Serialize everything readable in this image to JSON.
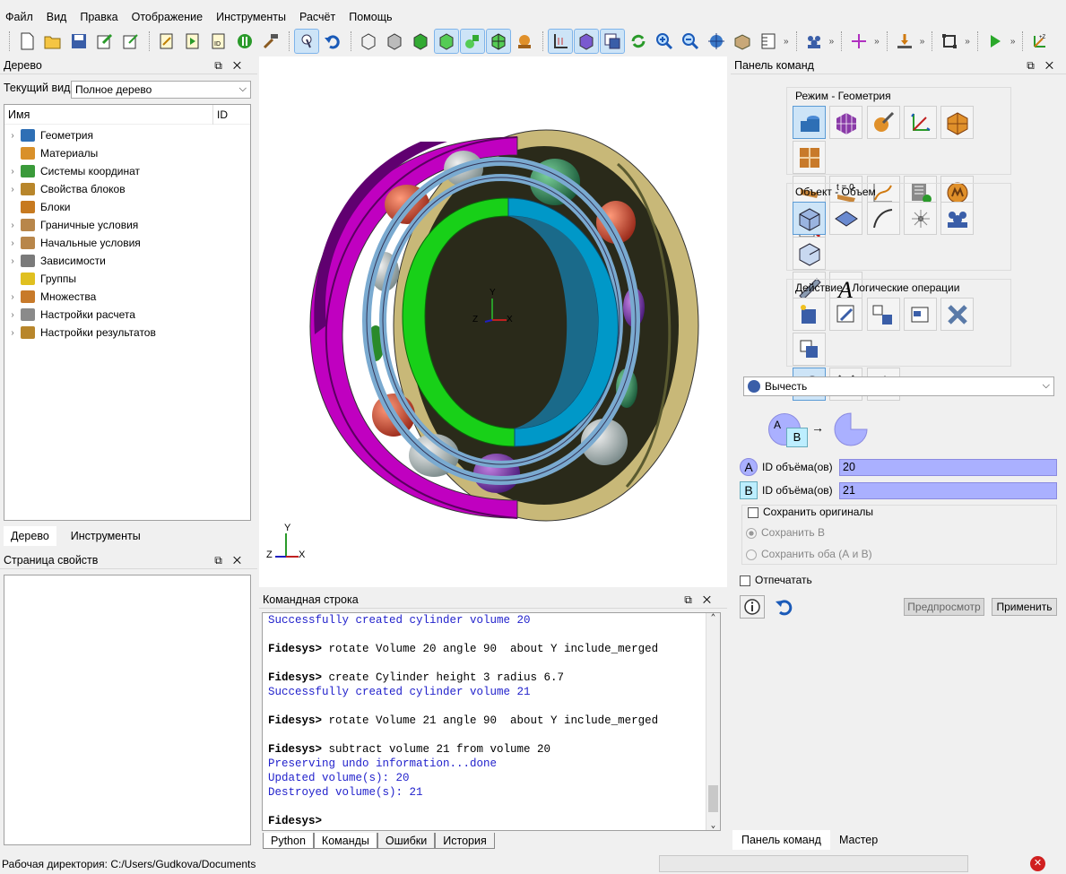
{
  "menu": [
    "Файл",
    "Вид",
    "Правка",
    "Отображение",
    "Инструменты",
    "Расчёт",
    "Помощь"
  ],
  "tree_panel": {
    "title": "Дерево",
    "current_view_label": "Текущий вид",
    "current_view_value": "Полное дерево",
    "col_name": "Имя",
    "col_id": "ID",
    "items": [
      {
        "label": "Геометрия",
        "icon": "geometry-icon",
        "expandable": true,
        "color": "#2e6fb5"
      },
      {
        "label": "Материалы",
        "icon": "materials-icon",
        "expandable": false,
        "color": "#d9902a"
      },
      {
        "label": "Системы координат",
        "icon": "coordinate-system-icon",
        "expandable": true,
        "color": "#3a9a3a"
      },
      {
        "label": "Свойства блоков",
        "icon": "block-properties-icon",
        "expandable": true,
        "color": "#b8862b"
      },
      {
        "label": "Блоки",
        "icon": "blocks-icon",
        "expandable": false,
        "color": "#c77a20"
      },
      {
        "label": "Граничные условия",
        "icon": "boundary-conditions-icon",
        "expandable": true,
        "color": "#b8864a"
      },
      {
        "label": "Начальные условия",
        "icon": "initial-conditions-icon",
        "expandable": true,
        "color": "#b8864a"
      },
      {
        "label": "Зависимости",
        "icon": "dependencies-icon",
        "expandable": true,
        "color": "#7a7a7a"
      },
      {
        "label": "Группы",
        "icon": "groups-icon",
        "expandable": false,
        "color": "#e0c020"
      },
      {
        "label": "Множества",
        "icon": "sets-icon",
        "expandable": true,
        "color": "#c87a2a"
      },
      {
        "label": "Настройки расчета",
        "icon": "calc-settings-icon",
        "expandable": true,
        "color": "#8a8a8a"
      },
      {
        "label": "Настройки результатов",
        "icon": "results-settings-icon",
        "expandable": true,
        "color": "#b8862b"
      }
    ],
    "tabs": [
      "Дерево",
      "Инструменты"
    ]
  },
  "properties_panel": {
    "title": "Страница свойств"
  },
  "command_line": {
    "title": "Командная строка",
    "lines": [
      {
        "t": "Successfully created cylinder volume 20",
        "k": "out"
      },
      {
        "t": "",
        "k": "blank"
      },
      {
        "p": "Fidesys>",
        "t": " rotate Volume 20 angle 90  about Y include_merged",
        "k": "cmd"
      },
      {
        "t": "",
        "k": "blank"
      },
      {
        "p": "Fidesys>",
        "t": " create Cylinder height 3 radius 6.7",
        "k": "cmd"
      },
      {
        "t": "Successfully created cylinder volume 21",
        "k": "out"
      },
      {
        "t": "",
        "k": "blank"
      },
      {
        "p": "Fidesys>",
        "t": " rotate Volume 21 angle 90  about Y include_merged",
        "k": "cmd"
      },
      {
        "t": "",
        "k": "blank"
      },
      {
        "p": "Fidesys>",
        "t": " subtract volume 21 from volume 20",
        "k": "cmd"
      },
      {
        "t": "Preserving undo information...done",
        "k": "out"
      },
      {
        "t": "Updated volume(s): 20",
        "k": "out"
      },
      {
        "t": "Destroyed volume(s): 21",
        "k": "out"
      },
      {
        "t": "",
        "k": "blank"
      },
      {
        "p": "Fidesys>",
        "t": "",
        "k": "cmd"
      }
    ],
    "tabs": [
      "Python",
      "Команды",
      "Ошибки",
      "История"
    ]
  },
  "command_panel": {
    "title": "Панель команд",
    "mode_group": "Режим - Геометрия",
    "object_group": "Объект - Объем",
    "action_group": "Действие - Логические операции",
    "operation": "Вычесть",
    "a_label": "A",
    "b_label": "B",
    "a_field_label": "ID объёма(ов)",
    "a_value": "20",
    "b_field_label": "ID объёма(ов)",
    "b_value": "21",
    "keep_originals": "Сохранить оригиналы",
    "keep_b": "Сохранить B",
    "keep_both": "Сохранить оба (А и В)",
    "imprint": "Отпечатать",
    "preview": "Предпросмотр",
    "apply": "Применить",
    "tabs": [
      "Панель команд",
      "Мастер"
    ]
  },
  "viewport": {
    "axis_labels": {
      "x": "X",
      "y": "Y",
      "z": "Z"
    }
  },
  "status": {
    "workdir": "Рабочая директория: C:/Users/Gudkova/Documents"
  },
  "colors": {
    "accent": "#cde4f7",
    "field": "#aab0ff",
    "magenta": "#c000c0",
    "green": "#18d018",
    "cyan": "#0090c0",
    "olive": "#c8b878"
  }
}
